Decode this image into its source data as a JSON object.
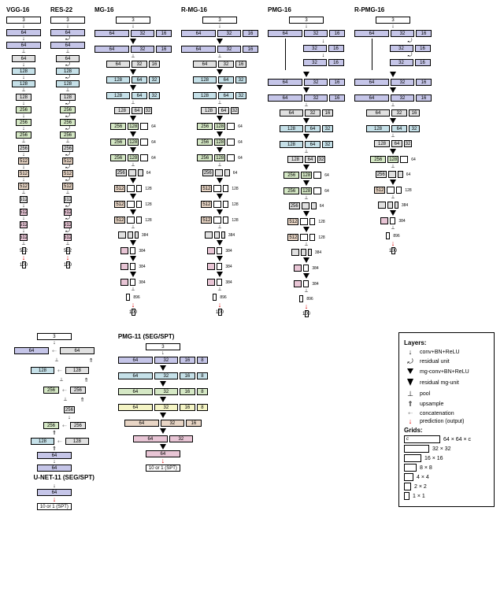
{
  "architectures": {
    "vgg": {
      "title": "VGG-16"
    },
    "res": {
      "title": "RES-22"
    },
    "mg": {
      "title": "MG-16"
    },
    "rmg": {
      "title": "R-MG-16"
    },
    "pmg": {
      "title": "PMG-16"
    },
    "rpmg": {
      "title": "R-PMG-16"
    },
    "unet": {
      "title": "U-NET-11 (SEG/SPT)"
    },
    "pmg11": {
      "title": "PMG-11 (SEG/SPT)"
    }
  },
  "channels": {
    "c3": "3",
    "c16": "16",
    "c32": "32",
    "c64": "64",
    "c128": "128",
    "c256": "256",
    "c384": "384",
    "c512": "512",
    "c896": "896",
    "c100": "100",
    "c10": "10 or 1 (SPT)"
  },
  "legend": {
    "layers_title": "Layers:",
    "conv": "conv+BN+ReLU",
    "residual": "residual unit",
    "mgconv": "mg-conv+BN+ReLU",
    "resmg": "residual mg-unit",
    "pool": "pool",
    "upsample": "upsample",
    "concat": "concatenation",
    "pred": "prediction (output)",
    "grids_title": "Grids:",
    "g64": "64 × 64 × c",
    "g32": "32 × 32",
    "g16": "16 × 16",
    "g8": "8 × 8",
    "g4": "4 × 4",
    "g2": "2 × 2",
    "g1": "1 × 1",
    "gc": "c"
  }
}
